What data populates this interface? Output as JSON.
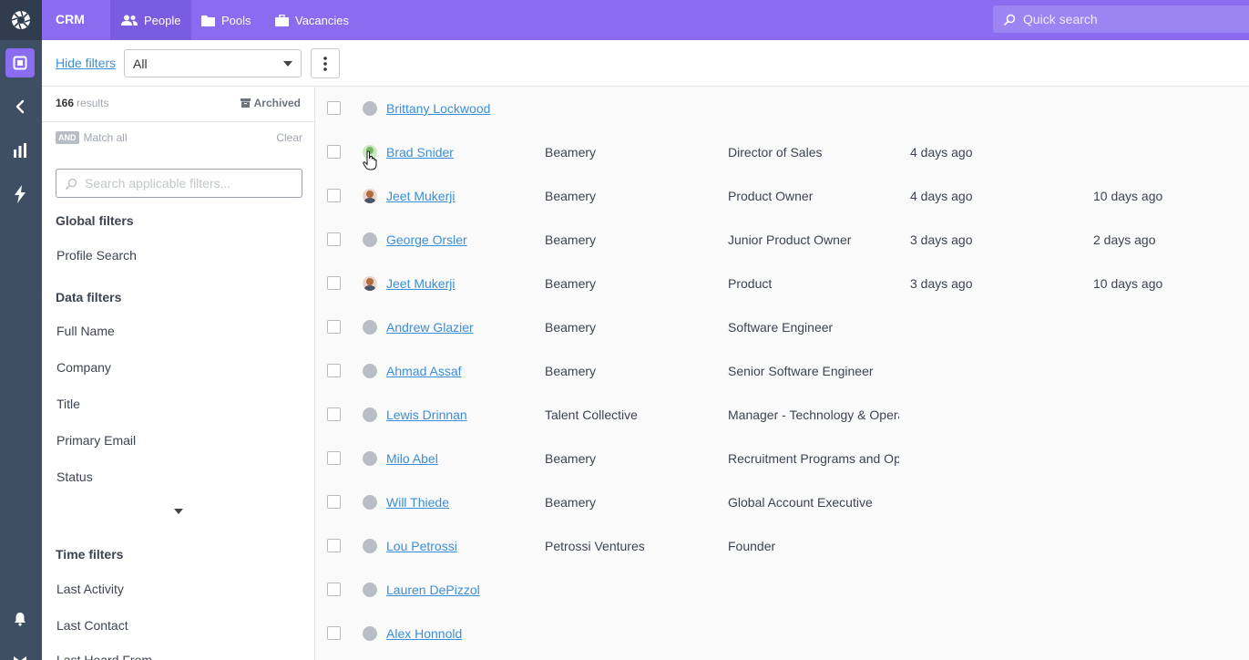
{
  "topbar": {
    "brand": "CRM",
    "tabs": [
      {
        "label": "People",
        "icon": "people-icon",
        "active": true
      },
      {
        "label": "Pools",
        "icon": "folder-icon",
        "active": false
      },
      {
        "label": "Vacancies",
        "icon": "briefcase-icon",
        "active": false
      }
    ],
    "search_placeholder": "Quick search"
  },
  "toolbar": {
    "hide_filters": "Hide filters",
    "view_select": "All"
  },
  "filters": {
    "results_count": "166",
    "results_label": "results",
    "archived": "Archived",
    "and_badge": "AND",
    "match_all": "Match all",
    "clear": "Clear",
    "search_placeholder": "Search applicable filters...",
    "global_heading": "Global filters",
    "global_items": [
      "Profile Search"
    ],
    "data_heading": "Data filters",
    "data_items": [
      "Full Name",
      "Company",
      "Title",
      "Primary Email",
      "Status"
    ],
    "time_heading": "Time filters",
    "time_items": [
      "Last Activity",
      "Last Contact",
      "Last Heard From"
    ]
  },
  "rows": [
    {
      "name": "Brittany Lockwood",
      "company": "",
      "title": "",
      "t1": "",
      "t2": "",
      "avatar": "none"
    },
    {
      "name": "Brad Snider",
      "company": "Beamery",
      "title": "Director of Sales",
      "t1": "4 days ago",
      "t2": "",
      "avatar": "green"
    },
    {
      "name": "Jeet Mukerji",
      "company": "Beamery",
      "title": "Product Owner",
      "t1": "4 days ago",
      "t2": "10 days ago",
      "avatar": "photo"
    },
    {
      "name": "George Orsler",
      "company": "Beamery",
      "title": "Junior Product Owner",
      "t1": "3 days ago",
      "t2": "2 days ago",
      "avatar": "none"
    },
    {
      "name": "Jeet Mukerji",
      "company": "Beamery",
      "title": "Product",
      "t1": "3 days ago",
      "t2": "10 days ago",
      "avatar": "photo"
    },
    {
      "name": "Andrew Glazier",
      "company": "Beamery",
      "title": "Software Engineer",
      "t1": "",
      "t2": "",
      "avatar": "none"
    },
    {
      "name": "Ahmad Assaf",
      "company": "Beamery",
      "title": "Senior Software Engineer",
      "t1": "",
      "t2": "",
      "avatar": "none"
    },
    {
      "name": "Lewis Drinnan",
      "company": "Talent Collective",
      "title": "Manager - Technology & Operations",
      "t1": "",
      "t2": "",
      "avatar": "none"
    },
    {
      "name": "Milo Abel",
      "company": "Beamery",
      "title": "Recruitment Programs and Operations",
      "t1": "",
      "t2": "",
      "avatar": "none"
    },
    {
      "name": "Will Thiede",
      "company": "Beamery",
      "title": "Global Account Executive",
      "t1": "",
      "t2": "",
      "avatar": "none"
    },
    {
      "name": "Lou Petrossi",
      "company": "Petrossi Ventures",
      "title": "Founder",
      "t1": "",
      "t2": "",
      "avatar": "none"
    },
    {
      "name": "Lauren DePizzol",
      "company": "",
      "title": "",
      "t1": "",
      "t2": "",
      "avatar": "none"
    },
    {
      "name": "Alex Honnold",
      "company": "",
      "title": "",
      "t1": "",
      "t2": "",
      "avatar": "none"
    }
  ],
  "colors": {
    "accent": "#8b6cf0",
    "rail": "#3f4f63",
    "link": "#3b8fd6"
  }
}
